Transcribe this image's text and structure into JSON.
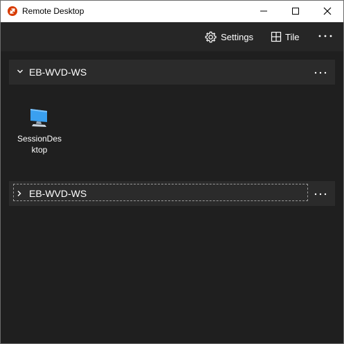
{
  "window": {
    "title": "Remote Desktop"
  },
  "toolbar": {
    "settings_label": "Settings",
    "tile_label": "Tile"
  },
  "groups": [
    {
      "name": "EB-WVD-WS",
      "expanded": true
    },
    {
      "name": "EB-WVD-WS",
      "expanded": false
    }
  ],
  "resources": [
    {
      "name": "SessionDesktop",
      "line1": "SessionDes",
      "line2": "ktop"
    }
  ],
  "colors": {
    "accent": "#d83b01",
    "background": "#1f1f1f",
    "toolbar": "#262626",
    "group_header": "#2b2b2b",
    "monitor": "#3aa0f0"
  }
}
